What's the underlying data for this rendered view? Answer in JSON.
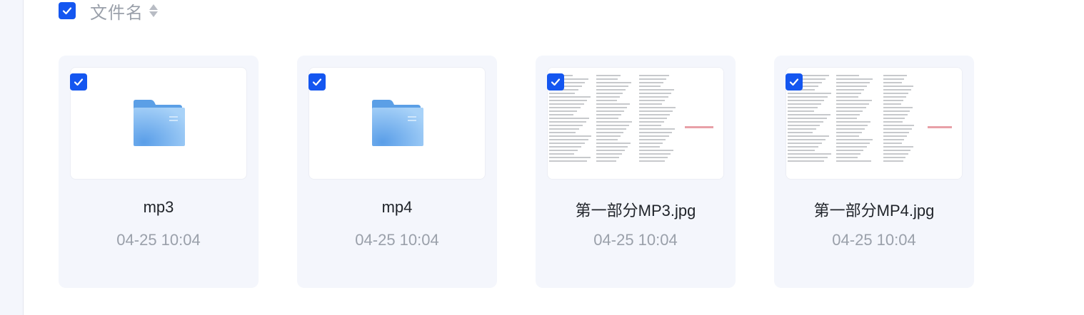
{
  "header": {
    "column_label": "文件名",
    "select_all_checked": true
  },
  "files": [
    {
      "name": "mp3",
      "date": "04-25 10:04",
      "type": "folder",
      "checked": true
    },
    {
      "name": "mp4",
      "date": "04-25 10:04",
      "type": "folder",
      "checked": true
    },
    {
      "name": "第一部分MP3.jpg",
      "date": "04-25 10:04",
      "type": "image",
      "checked": true
    },
    {
      "name": "第一部分MP4.jpg",
      "date": "04-25 10:04",
      "type": "image",
      "checked": true
    }
  ],
  "colors": {
    "accent": "#1456f0",
    "card_bg": "#f4f6fc",
    "folder": "#7fb8f0"
  }
}
